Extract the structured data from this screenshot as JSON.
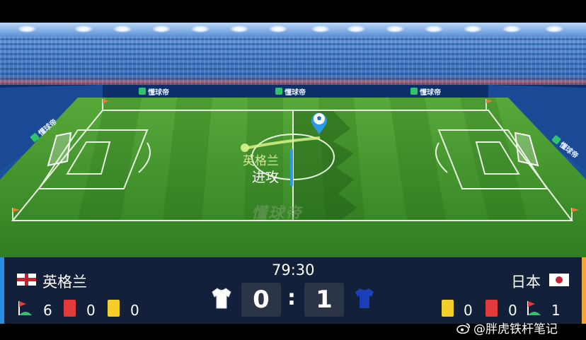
{
  "ads": {
    "brand": "懂球帝",
    "watermark": "懂球帝"
  },
  "attack": {
    "team": "英格兰",
    "label": "进攻"
  },
  "match": {
    "clock": "79:30",
    "separator": ":",
    "home": {
      "name": "英格兰",
      "score": "0",
      "corners": "6",
      "red_cards": "0",
      "yellow_cards": "0",
      "shirt_color": "#ffffff"
    },
    "away": {
      "name": "日本",
      "score": "1",
      "corners": "1",
      "red_cards": "0",
      "yellow_cards": "0",
      "shirt_color": "#1a3fb8"
    }
  },
  "watermark": {
    "text": "@胖虎铁杆笔记"
  },
  "colors": {
    "pitch_green": "#3d8f2a",
    "scorebar_bg": "#13203a",
    "home_accent": "#2a8ee0",
    "away_accent": "#f1a534",
    "red_card": "#e33b3b",
    "yellow_card": "#f4cf2a"
  },
  "icons": [
    "soccer-ball-pin-icon",
    "corner-flag-icon",
    "red-card-icon",
    "yellow-card-icon",
    "home-shirt-icon",
    "away-shirt-icon",
    "england-flag-icon",
    "japan-flag-icon",
    "weibo-icon"
  ]
}
